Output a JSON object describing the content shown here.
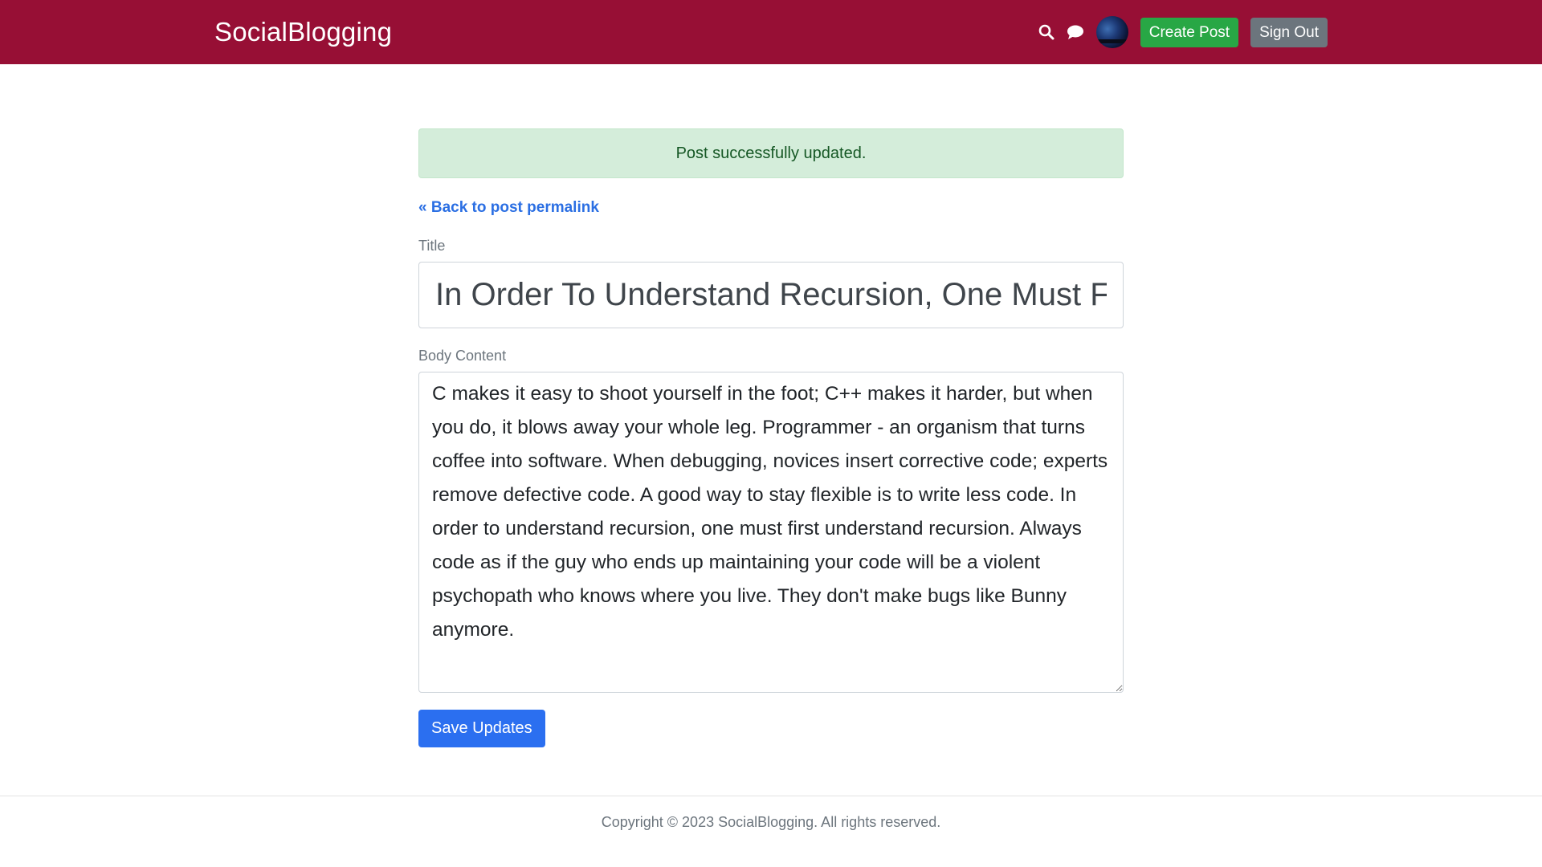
{
  "header": {
    "brand": "SocialBlogging",
    "background_color": "#970f35",
    "icons": [
      "search-icon",
      "chat-icon"
    ],
    "create_post_label": "Create Post",
    "sign_out_label": "Sign Out"
  },
  "alert": {
    "message": "Post successfully updated.",
    "color": "#d4edda"
  },
  "form": {
    "back_link": "« Back to post permalink",
    "title_label": "Title",
    "title_value": "In Order To Understand Recursion, One Must First Understand Recursion.",
    "body_label": "Body Content",
    "body_value": "C makes it easy to shoot yourself in the foot; C++ makes it harder, but when you do, it blows away your whole leg. Programmer - an organism that turns coffee into software. When debugging, novices insert corrective code; experts remove defective code. A good way to stay flexible is to write less code. In order to understand recursion, one must first understand recursion. Always code as if the guy who ends up maintaining your code will be a violent psychopath who knows where you live. They don't make bugs like Bunny anymore.",
    "save_label": "Save Updates"
  },
  "footer": {
    "copyright": "Copyright © 2023 SocialBlogging. All rights reserved."
  }
}
